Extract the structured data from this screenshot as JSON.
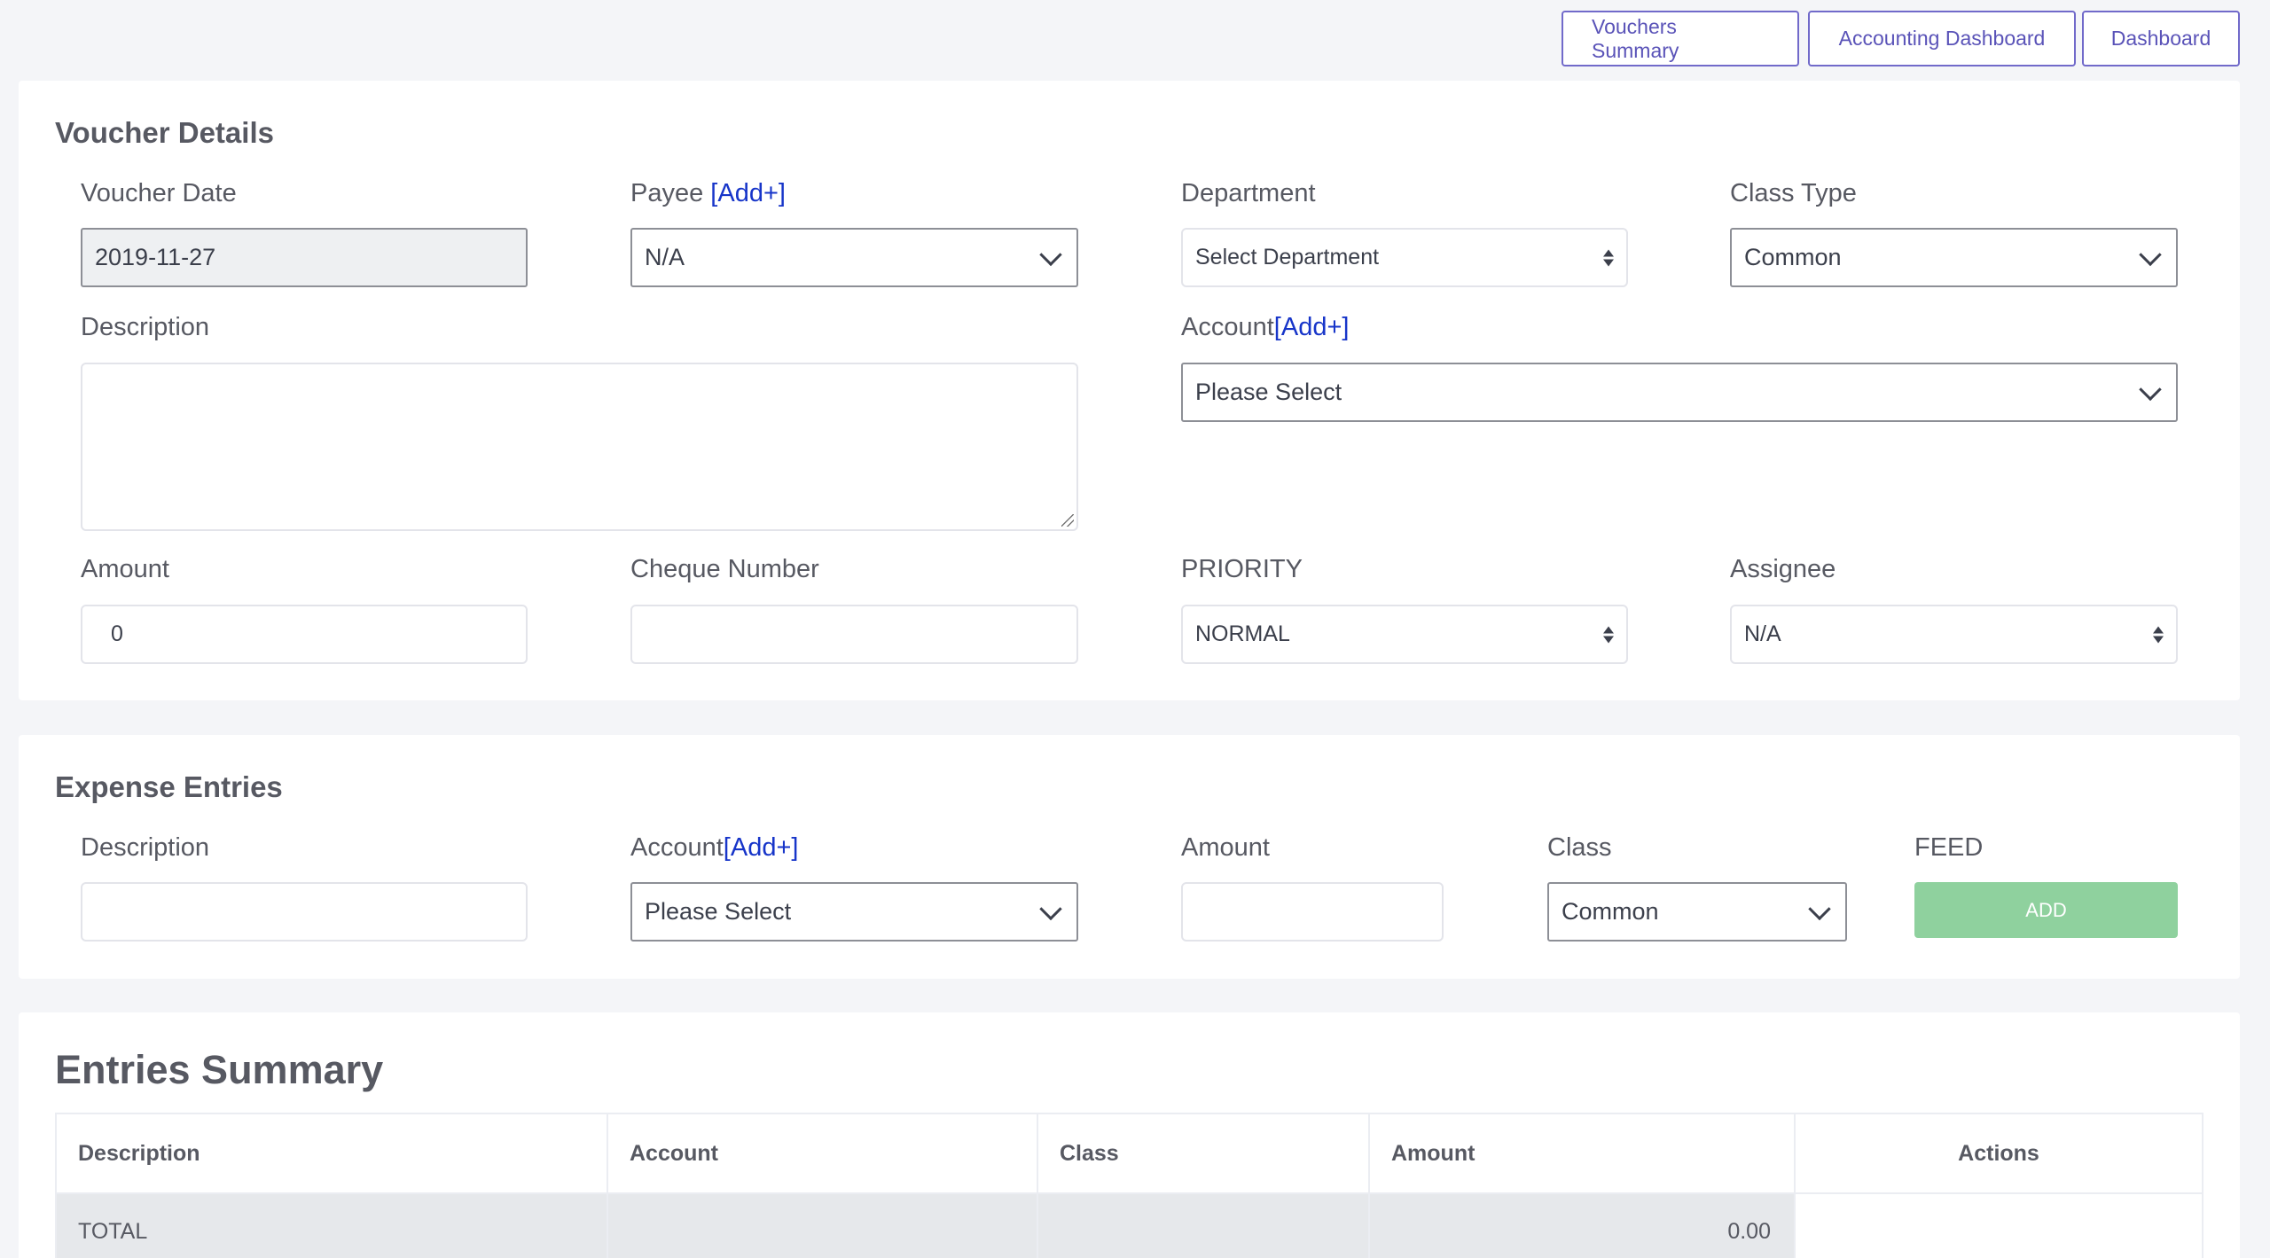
{
  "nav": {
    "vouchers_summary": "Vouchers Summary",
    "accounting_dashboard": "Accounting Dashboard",
    "dashboard": "Dashboard"
  },
  "voucher_details": {
    "title": "Voucher Details",
    "voucher_date_label": "Voucher Date",
    "voucher_date_value": "2019-11-27",
    "payee_label": "Payee",
    "add_link": "[Add+]",
    "payee_value": "N/A",
    "department_label": "Department",
    "department_value": "Select Department",
    "class_type_label": "Class Type",
    "class_type_value": "Common",
    "description_label": "Description",
    "account_label": "Account",
    "account_value": "Please Select",
    "amount_label": "Amount",
    "amount_value": "0",
    "cheque_label": "Cheque Number",
    "priority_label": "PRIORITY",
    "priority_value": "NORMAL",
    "assignee_label": "Assignee",
    "assignee_value": "N/A"
  },
  "expense_entries": {
    "title": "Expense Entries",
    "description_label": "Description",
    "account_label": "Account",
    "add_link": "[Add+]",
    "account_value": "Please Select",
    "amount_label": "Amount",
    "class_label": "Class",
    "class_value": "Common",
    "feed_label": "FEED",
    "add_button": "ADD"
  },
  "entries_summary": {
    "title": "Entries Summary",
    "columns": [
      "Description",
      "Account",
      "Class",
      "Amount",
      "Actions"
    ],
    "total_label": "TOTAL",
    "total_amount": "0.00"
  },
  "colors": {
    "accent": "#716aca",
    "add_link": "#1735c9",
    "add_button": "#8fd19e",
    "total_row": "#e6e8eb"
  }
}
